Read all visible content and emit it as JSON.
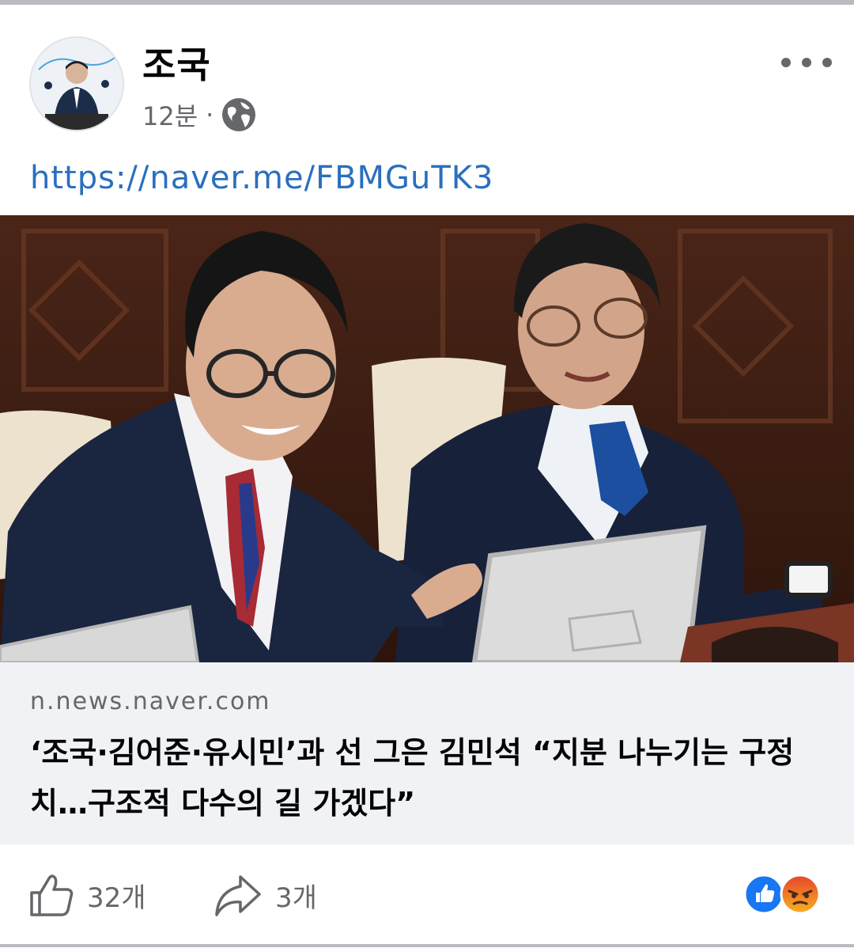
{
  "post": {
    "author": "조국",
    "time": "12분",
    "separator": "·",
    "privacy_icon": "globe-icon",
    "more_icon": "more-options-icon",
    "link_text": "https://naver.me/FBMGuTK3"
  },
  "preview": {
    "domain": "n.news.naver.com",
    "headline": "‘조국·김어준·유시민’과 선 그은 김민석 “지분 나누기는 구정치…구조적 다수의 길 가겠다”"
  },
  "actions": {
    "like_icon": "thumbs-up-icon",
    "like_count": "32개",
    "share_icon": "share-arrow-icon",
    "share_count": "3개",
    "reactions": [
      "like-reaction-icon",
      "angry-reaction-icon"
    ]
  },
  "colors": {
    "link": "#2a6fbf",
    "meta_text": "#65676b",
    "preview_bg": "#f0f2f5",
    "like_blue": "#1877f2",
    "angry_orange": "#f0582a"
  }
}
